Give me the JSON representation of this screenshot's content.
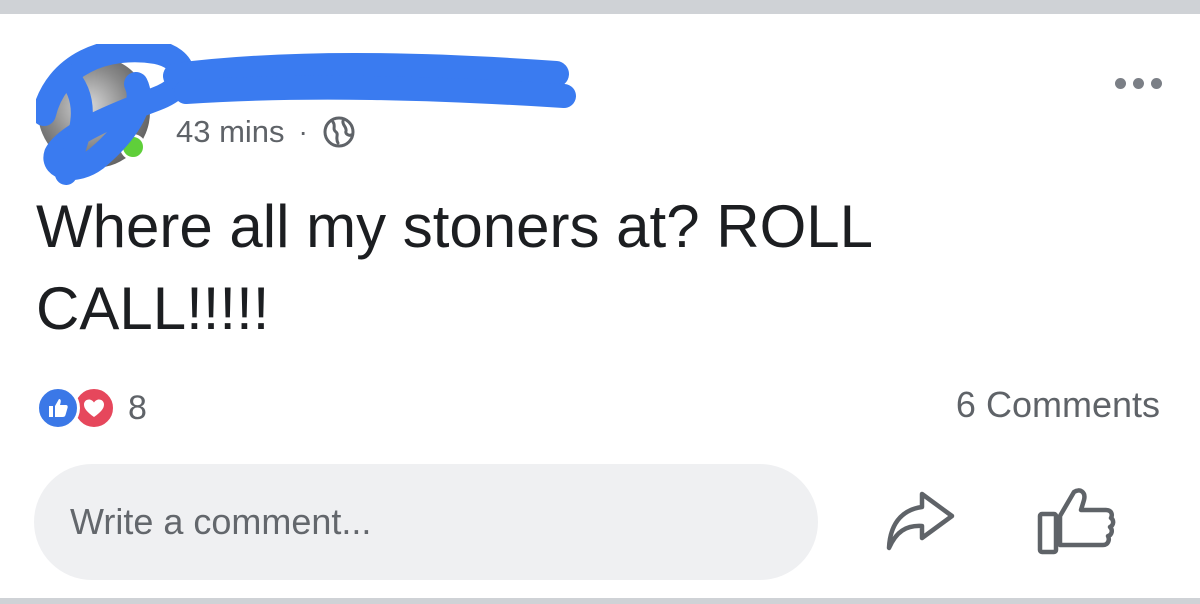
{
  "post": {
    "timestamp": "43 mins",
    "separator": "·",
    "privacy_icon": "globe-icon",
    "text": "Where all my stoners at? ROLL CALL!!!!!",
    "online_status_color": "#5fcf3a",
    "redaction_color": "#3a7bf0"
  },
  "reactions": {
    "icons": [
      "like-reaction-icon",
      "love-reaction-icon"
    ],
    "count": "8",
    "like_color": "#3b78e7",
    "love_color": "#e6475c"
  },
  "comments": {
    "count_label": "6 Comments"
  },
  "composer": {
    "placeholder": "Write a comment..."
  },
  "actions": {
    "share_icon": "share-arrow-icon",
    "like_icon": "thumbs-up-icon",
    "more_icon": "more-options-icon"
  }
}
